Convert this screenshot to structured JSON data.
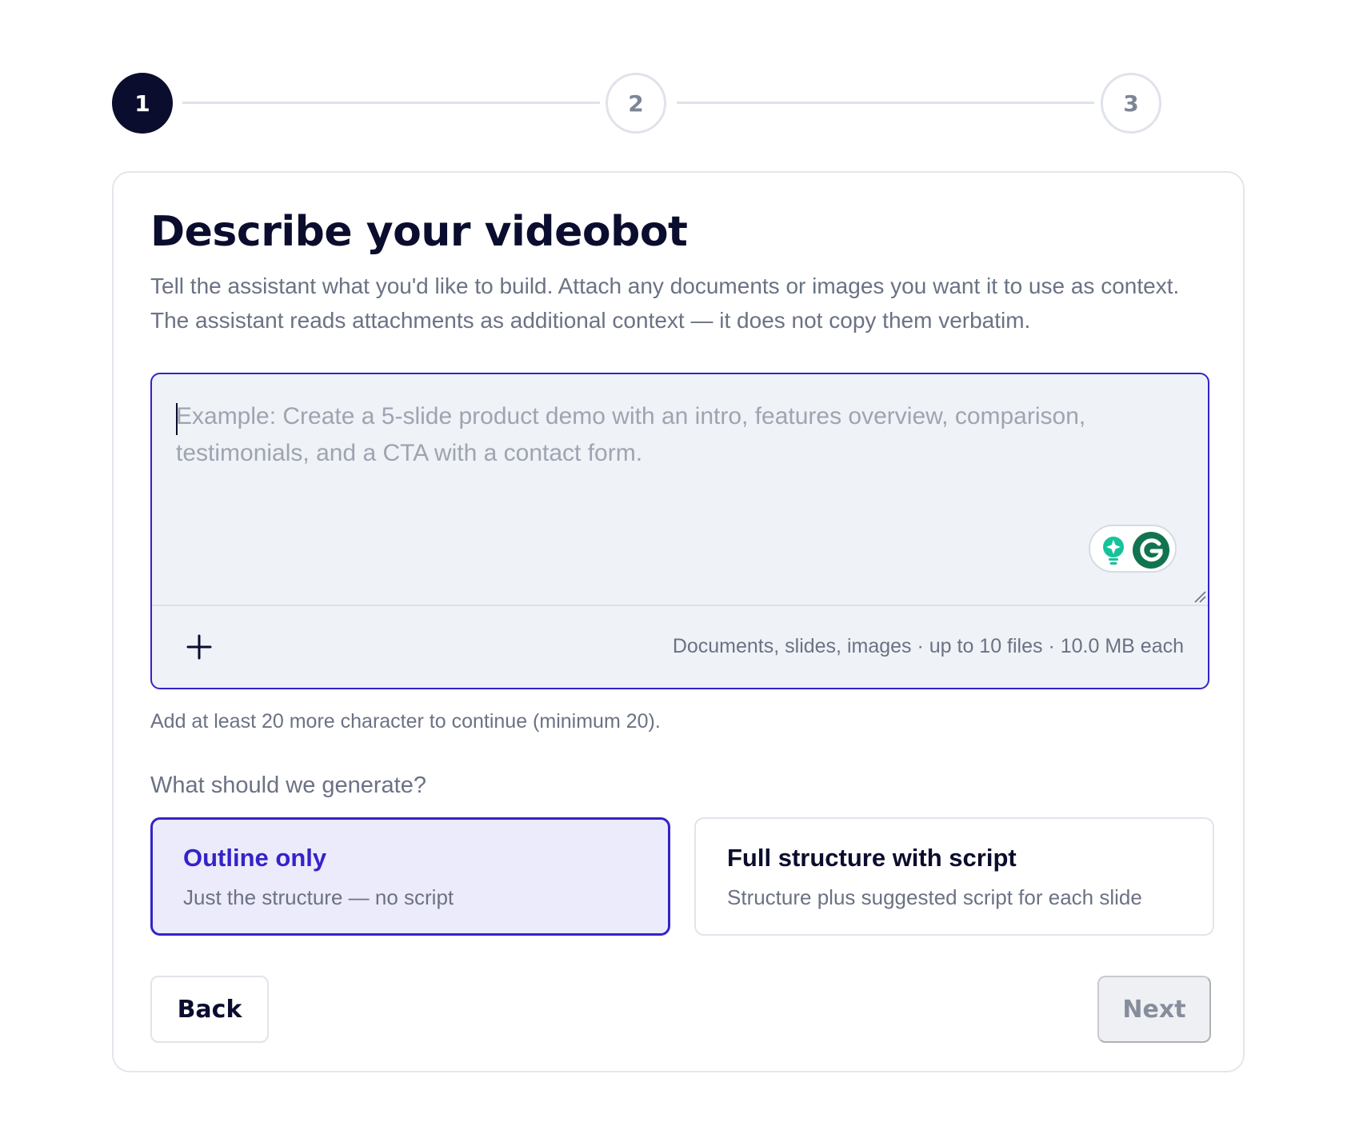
{
  "stepper": {
    "steps": [
      {
        "label": "1",
        "state": "active"
      },
      {
        "label": "2",
        "state": "inactive"
      },
      {
        "label": "3",
        "state": "inactive"
      }
    ]
  },
  "card": {
    "title": "Describe your videobot",
    "subtitle": "Tell the assistant what you'd like to build. Attach any documents or images you want it to use as context. The assistant reads attachments as additional context — it does not copy them verbatim."
  },
  "composer": {
    "value": "",
    "placeholder": "Example: Create a 5-slide product demo with an intro, features overview, comparison, testimonials, and a CTA with a contact form.",
    "attach_icon": "plus-icon",
    "attach_note": "Documents, slides, images · up to 10 files · 10.0 MB each",
    "extension_icons": [
      "lightbulb-icon",
      "grammarly-icon"
    ]
  },
  "hint": "Add at least 20 more character to continue (minimum 20).",
  "generate": {
    "question": "What should we generate?",
    "options": [
      {
        "title": "Outline only",
        "description": "Just the structure — no script",
        "selected": true
      },
      {
        "title": "Full structure with script",
        "description": "Structure plus suggested script for each slide",
        "selected": false
      }
    ]
  },
  "actions": {
    "back_label": "Back",
    "next_label": "Next",
    "next_enabled": false
  },
  "colors": {
    "accent": "#3423c9",
    "dark": "#0b0d2e",
    "muted_text": "#6b7284",
    "selected_bg": "#ecebfb",
    "grammarly_green": "#15c39a"
  }
}
